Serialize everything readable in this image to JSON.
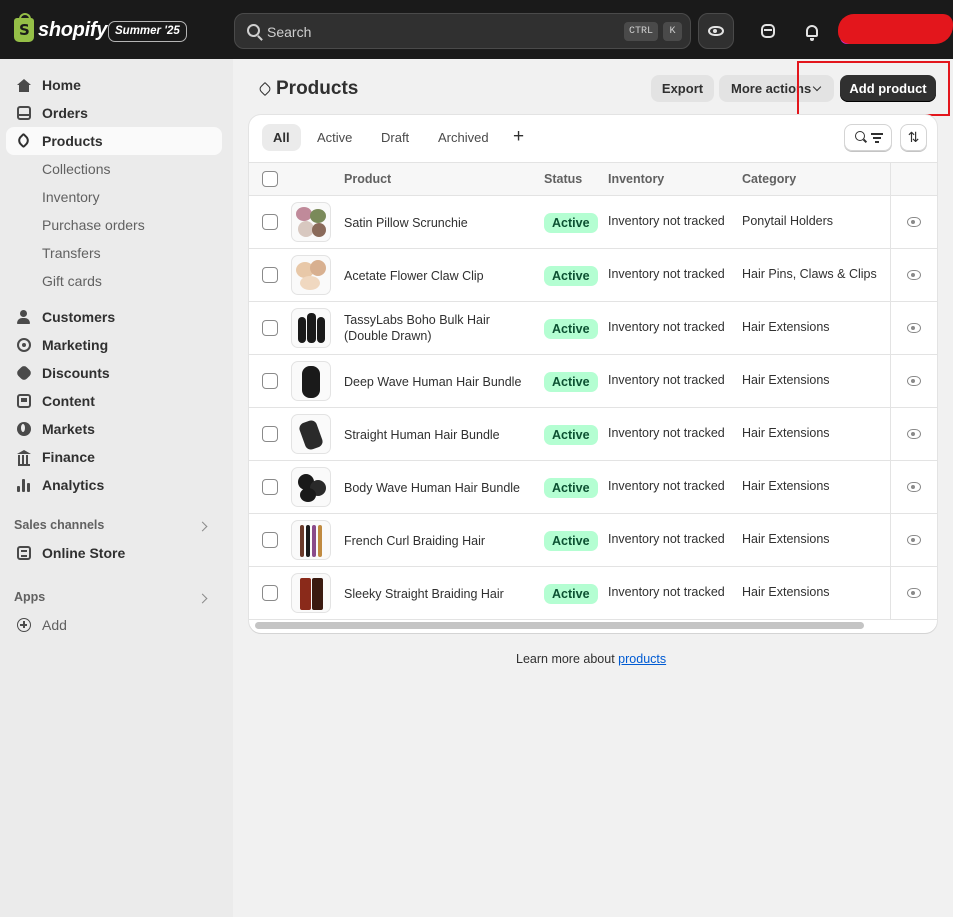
{
  "topbar": {
    "logo_text": "shopify",
    "edition": "Summer '25",
    "search_placeholder": "Search",
    "shortcut_ctrl": "CTRL",
    "shortcut_k": "K"
  },
  "sidebar": {
    "items": [
      {
        "label": "Home",
        "icon": "home-icon"
      },
      {
        "label": "Orders",
        "icon": "orders-icon"
      },
      {
        "label": "Products",
        "icon": "tag-icon",
        "active": true
      },
      {
        "label": "Collections",
        "sub": true
      },
      {
        "label": "Inventory",
        "sub": true
      },
      {
        "label": "Purchase orders",
        "sub": true
      },
      {
        "label": "Transfers",
        "sub": true
      },
      {
        "label": "Gift cards",
        "sub": true
      },
      {
        "label": "Customers",
        "icon": "person-icon"
      },
      {
        "label": "Marketing",
        "icon": "target-icon"
      },
      {
        "label": "Discounts",
        "icon": "discount-icon"
      },
      {
        "label": "Content",
        "icon": "content-icon"
      },
      {
        "label": "Markets",
        "icon": "globe-icon"
      },
      {
        "label": "Finance",
        "icon": "bank-icon"
      },
      {
        "label": "Analytics",
        "icon": "bar-chart-icon"
      }
    ],
    "sales_channels_title": "Sales channels",
    "online_store": "Online Store",
    "apps_title": "Apps",
    "add_label": "Add"
  },
  "page": {
    "title": "Products",
    "export_label": "Export",
    "more_actions_label": "More actions",
    "add_product_label": "Add product"
  },
  "tabs": [
    "All",
    "Active",
    "Draft",
    "Archived"
  ],
  "table": {
    "headers": {
      "product": "Product",
      "status": "Status",
      "inventory": "Inventory",
      "category": "Category"
    },
    "rows": [
      {
        "name": "Satin Pillow Scrunchie",
        "status": "Active",
        "inventory": "Inventory not tracked",
        "category": "Ponytail Holders"
      },
      {
        "name": "Acetate Flower Claw Clip",
        "status": "Active",
        "inventory": "Inventory not tracked",
        "category": "Hair Pins, Claws & Clips"
      },
      {
        "name": "TassyLabs Boho Bulk Hair (Double Drawn)",
        "status": "Active",
        "inventory": "Inventory not tracked",
        "category": "Hair Extensions"
      },
      {
        "name": "Deep Wave Human Hair Bundle",
        "status": "Active",
        "inventory": "Inventory not tracked",
        "category": "Hair Extensions"
      },
      {
        "name": "Straight Human Hair Bundle",
        "status": "Active",
        "inventory": "Inventory not tracked",
        "category": "Hair Extensions"
      },
      {
        "name": "Body Wave Human Hair Bundle",
        "status": "Active",
        "inventory": "Inventory not tracked",
        "category": "Hair Extensions"
      },
      {
        "name": "French Curl Braiding Hair",
        "status": "Active",
        "inventory": "Inventory not tracked",
        "category": "Hair Extensions"
      },
      {
        "name": "Sleeky Straight Braiding Hair",
        "status": "Active",
        "inventory": "Inventory not tracked",
        "category": "Hair Extensions"
      }
    ]
  },
  "footer": {
    "learn_prefix": "Learn more about",
    "learn_link": "products"
  },
  "colors": {
    "topbar": "#1a1a1a",
    "primary_button": "#303030",
    "active_badge_bg": "#b4fed2",
    "active_badge_text": "#0c5132",
    "link": "#005bd3",
    "highlight": "#e3161c"
  }
}
